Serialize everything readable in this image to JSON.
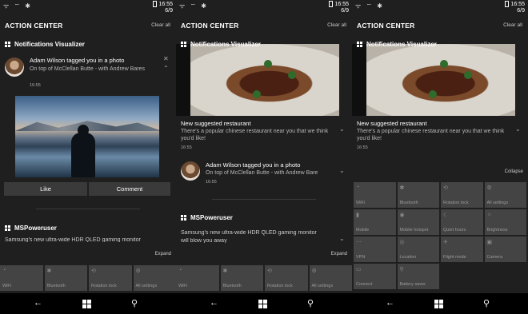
{
  "status": {
    "time": "16:55",
    "date": "6/9",
    "icons": "ᯤ  ⌔  ✱"
  },
  "action_center": {
    "title": "ACTION CENTER",
    "clear_all": "Clear all",
    "expand": "Expand",
    "collapse": "Collapse"
  },
  "app_notifications": "Notifications Visualizer",
  "app_mspoweruser": "MSPoweruser",
  "notif_adam": {
    "title": "Adam Wilson tagged you in a photo",
    "body_p1": "On top of McClellan Butte - with Andrew Bares",
    "body_p2": "On top of McClellan Butte - with Andrew Bare",
    "time": "16:55"
  },
  "notif_restaurant": {
    "title": "New suggested restaurant",
    "body": "There's a popular chinese restaurant near you that we think you'd like!",
    "time": "16:55"
  },
  "buttons": {
    "like": "Like",
    "comment": "Comment"
  },
  "mspu_text_p1": "Samsung's new ultra-wide HDR QLED gaming monitor",
  "mspu_text_p2a": "Samsung's new ultra-wide HDR QLED gaming monitor",
  "mspu_text_p2b": "will blow you away",
  "quick_actions_collapsed": [
    {
      "label": "WiFi",
      "icon": "wifi-icon",
      "glyph": "◔"
    },
    {
      "label": "Bluetooth",
      "icon": "bluetooth-icon",
      "glyph": "✱"
    },
    {
      "label": "Rotation lock",
      "icon": "rotation-lock-icon",
      "glyph": "⟲"
    },
    {
      "label": "All settings",
      "icon": "settings-icon",
      "glyph": "⚙"
    }
  ],
  "quick_actions_expanded": [
    {
      "label": "WiFi",
      "icon": "wifi-icon",
      "glyph": "◔"
    },
    {
      "label": "Bluetooth",
      "icon": "bluetooth-icon",
      "glyph": "✱"
    },
    {
      "label": "Rotation lock",
      "icon": "rotation-lock-icon",
      "glyph": "⟲"
    },
    {
      "label": "All settings",
      "icon": "settings-icon",
      "glyph": "⚙"
    },
    {
      "label": "Mobile",
      "icon": "mobile-data-icon",
      "glyph": "▮"
    },
    {
      "label": "Mobile hotspot",
      "icon": "hotspot-icon",
      "glyph": "◉"
    },
    {
      "label": "Quiet hours",
      "icon": "moon-icon",
      "glyph": "☾"
    },
    {
      "label": "Brightness",
      "icon": "brightness-icon",
      "glyph": "☼"
    },
    {
      "label": "VPN",
      "icon": "vpn-icon",
      "glyph": "⋯"
    },
    {
      "label": "Location",
      "icon": "location-icon",
      "glyph": "◎"
    },
    {
      "label": "Flight mode",
      "icon": "airplane-icon",
      "glyph": "✈"
    },
    {
      "label": "Camera",
      "icon": "camera-icon",
      "glyph": "▣"
    },
    {
      "label": "Connect",
      "icon": "connect-icon",
      "glyph": "▭"
    },
    {
      "label": "Battery saver",
      "icon": "battery-saver-icon",
      "glyph": "⚲"
    }
  ]
}
